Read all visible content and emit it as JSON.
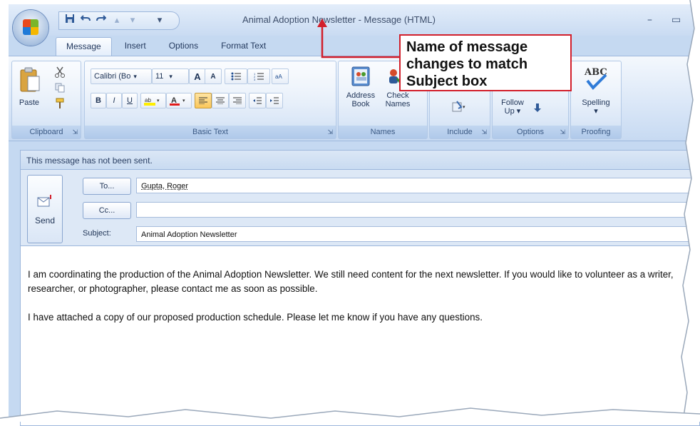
{
  "window": {
    "title": "Animal Adoption Newsletter - Message (HTML)",
    "minimize": "–",
    "maximize": "▭"
  },
  "qat": [
    "save-icon",
    "undo-icon",
    "redo-icon",
    "up-icon",
    "down-icon",
    "customize-icon"
  ],
  "tabs": [
    {
      "label": "Message"
    },
    {
      "label": "Insert"
    },
    {
      "label": "Options"
    },
    {
      "label": "Format Text"
    }
  ],
  "ribbon": {
    "clipboard": {
      "paste": "Paste",
      "group": "Clipboard"
    },
    "basic_text": {
      "font": "Calibri (Bo",
      "size": "11",
      "group": "Basic Text"
    },
    "names": {
      "address": "Address Book",
      "address1": "Address",
      "address2": "Book",
      "check1": "Check",
      "check2": "Names",
      "group": "Names"
    },
    "include": {
      "group": "Include"
    },
    "options": {
      "follow1": "Follow",
      "follow2": "Up",
      "group": "Options"
    },
    "proofing": {
      "abc": "ABC",
      "spelling": "Spelling",
      "group": "Proofing"
    }
  },
  "callout": {
    "line1": "Name of message",
    "line2": "changes to match",
    "line3": "Subject box"
  },
  "message": {
    "info": "This message has not been sent.",
    "send": "Send",
    "to_label": "To...",
    "to_value": "Gupta, Roger",
    "cc_label": "Cc...",
    "cc_value": "",
    "subject_label": "Subject:",
    "subject_value": "Animal Adoption Newsletter",
    "body_p1": "I am coordinating the production of the Animal Adoption Newsletter. We still need content for the next newsletter. If you would like to volunteer as a writer, researcher, or photographer, please contact me as soon as possible.",
    "body_p2": "I have attached a copy of our proposed production schedule. Please let me know if you have any questions."
  },
  "colors": {
    "callout_border": "#d21f2b",
    "ribbon": "#c5d9f1"
  }
}
